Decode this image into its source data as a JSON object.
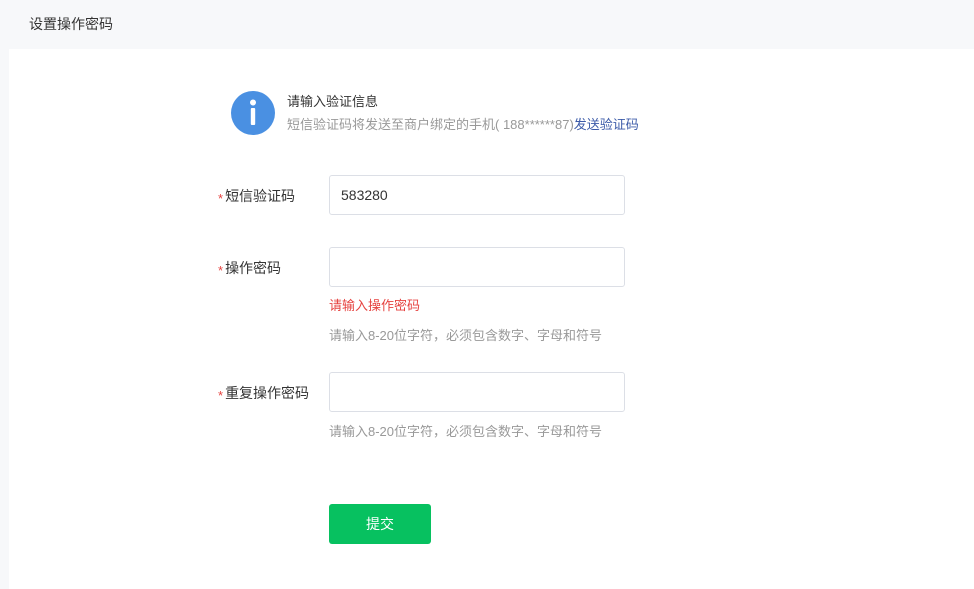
{
  "page": {
    "title": "设置操作密码"
  },
  "notice": {
    "icon": "info-icon",
    "title": "请输入验证信息",
    "desc_prefix": "短信验证码将发送至商户绑定的手机( 188******87)",
    "send_link": "发送验证码"
  },
  "form": {
    "required_mark": "*",
    "sms_code": {
      "label": "短信验证码",
      "value": "583280",
      "placeholder": ""
    },
    "password": {
      "label": "操作密码",
      "value": "",
      "placeholder": "",
      "error": "请输入操作密码",
      "hint": "请输入8-20位字符，必须包含数字、字母和符号"
    },
    "repeat_password": {
      "label": "重复操作密码",
      "value": "",
      "placeholder": "",
      "hint": "请输入8-20位字符，必须包含数字、字母和符号"
    },
    "submit_label": "提交"
  },
  "colors": {
    "accent_green": "#07c160",
    "info_blue": "#4a90e2",
    "error_red": "#e64340",
    "link_blue": "#3b5aa8"
  }
}
